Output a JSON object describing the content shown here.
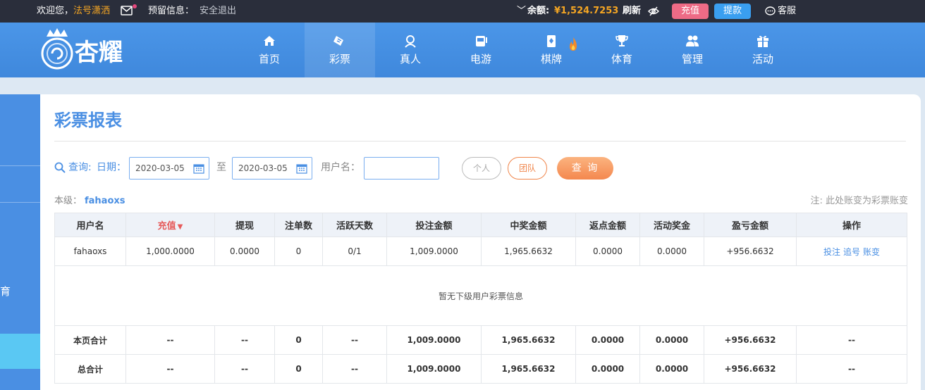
{
  "topbar": {
    "welcome": "欢迎您，",
    "username": "法号潇洒",
    "reserve_label": "预留信息：",
    "logout": "安全退出",
    "balance_label": "余额:",
    "balance": "¥1,524.7253",
    "refresh": "刷新",
    "recharge": "充值",
    "withdraw": "提款",
    "service": "客服",
    "mail_icon": "mail-icon",
    "eye_icon": "eye-off-icon",
    "service_icon": "chat-icon"
  },
  "brand": {
    "logo": "杏耀"
  },
  "nav": [
    {
      "label": "首页",
      "icon": "home-icon"
    },
    {
      "label": "彩票",
      "icon": "lottery-icon"
    },
    {
      "label": "真人",
      "icon": "person-icon"
    },
    {
      "label": "电游",
      "icon": "slot-icon"
    },
    {
      "label": "棋牌",
      "icon": "cards-icon"
    },
    {
      "label": "体育",
      "icon": "trophy-icon"
    },
    {
      "label": "管理",
      "icon": "users-icon"
    },
    {
      "label": "活动",
      "icon": "gift-icon"
    }
  ],
  "sidebar": {
    "partial_label": "育"
  },
  "page": {
    "title": "彩票报表",
    "query_label": "查询:",
    "date_label": "日期：",
    "date_from": "2020-03-05",
    "date_to": "2020-03-05",
    "to_label": "至",
    "username_label": "用户名：",
    "username_value": "",
    "btn_personal": "个人",
    "btn_team": "团队",
    "btn_query": "查 询",
    "level_label": "本级：",
    "level_user": "fahaoxs",
    "note": "注: 此处账变为彩票账变"
  },
  "table": {
    "headers": [
      "用户名",
      "充值",
      "提现",
      "注单数",
      "活跃天数",
      "投注金额",
      "中奖金额",
      "返点金额",
      "活动奖金",
      "盈亏金额",
      "操作"
    ],
    "sort_indicator": "▼",
    "row": {
      "username": "fahaoxs",
      "recharge": "1,000.0000",
      "withdraw": "0.0000",
      "orders": "0",
      "active_days": "0/1",
      "bet": "1,009.0000",
      "win": "1,965.6632",
      "rebate": "0.0000",
      "bonus": "0.0000",
      "profit": "+956.6632",
      "ops": [
        "投注",
        "追号",
        "账变"
      ]
    },
    "empty_text": "暂无下级用户彩票信息",
    "page_total": {
      "label": "本页合计",
      "recharge": "--",
      "withdraw": "--",
      "orders": "0",
      "active_days": "--",
      "bet": "1,009.0000",
      "win": "1,965.6632",
      "rebate": "0.0000",
      "bonus": "0.0000",
      "profit": "+956.6632",
      "ops": "--"
    },
    "grand_total": {
      "label": "总合计",
      "recharge": "--",
      "withdraw": "--",
      "orders": "0",
      "active_days": "--",
      "bet": "1,009.0000",
      "win": "1,965.6632",
      "rebate": "0.0000",
      "bonus": "0.0000",
      "profit": "+956.6632",
      "ops": "--"
    }
  }
}
